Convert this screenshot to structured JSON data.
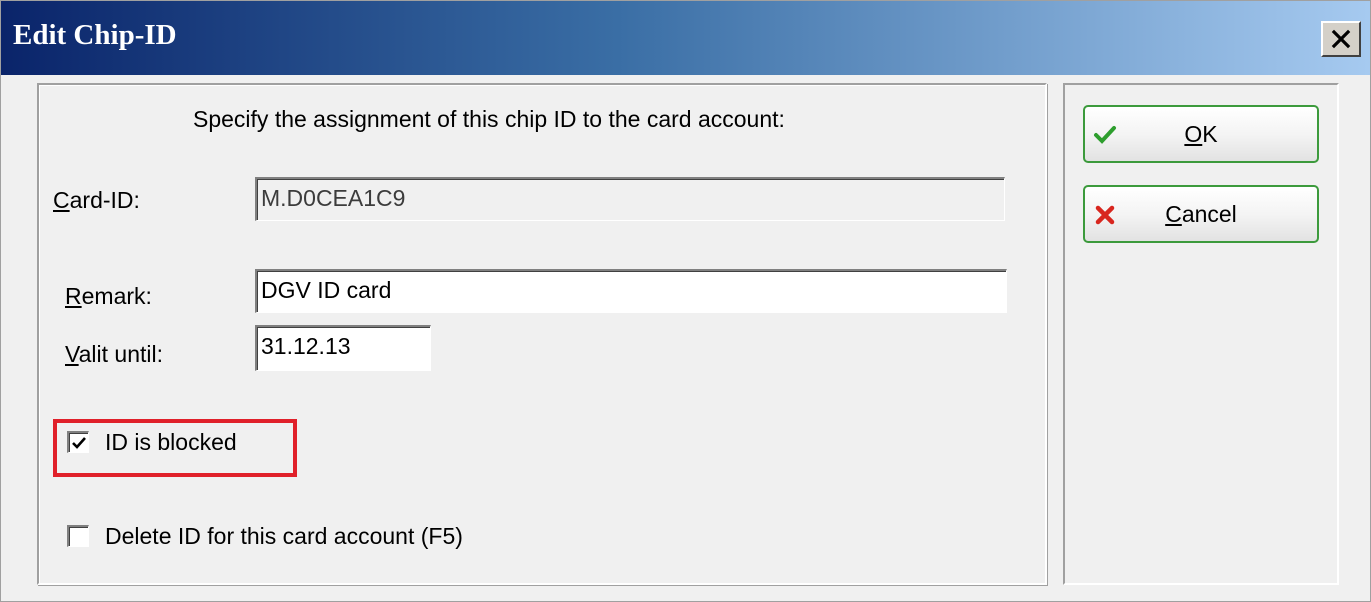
{
  "window": {
    "title": "Edit Chip-ID"
  },
  "form": {
    "instruction": "Specify the assignment of this chip ID to the card account:",
    "card_id": {
      "label_underlined": "C",
      "label_rest": "ard-ID:",
      "value": "M.D0CEA1C9"
    },
    "remark": {
      "label_underlined": "R",
      "label_rest": "emark:",
      "value": "DGV ID card"
    },
    "valid_until": {
      "label_underlined": "V",
      "label_rest": "alit until:",
      "value": "31.12.13"
    },
    "id_blocked": {
      "label": "ID is blocked",
      "checked": true
    },
    "delete_id": {
      "label": "Delete ID for this card account (F5)",
      "checked": false
    }
  },
  "buttons": {
    "ok": {
      "label_underlined": "O",
      "label_rest": "K",
      "icon": "check-icon"
    },
    "cancel": {
      "label_underlined": "C",
      "label_rest": "ancel",
      "icon": "cross-icon"
    }
  },
  "colors": {
    "highlight": "#e0202a",
    "button_border": "#3c9a3c",
    "check_green": "#2e9e2e",
    "cancel_red": "#d8261e"
  }
}
